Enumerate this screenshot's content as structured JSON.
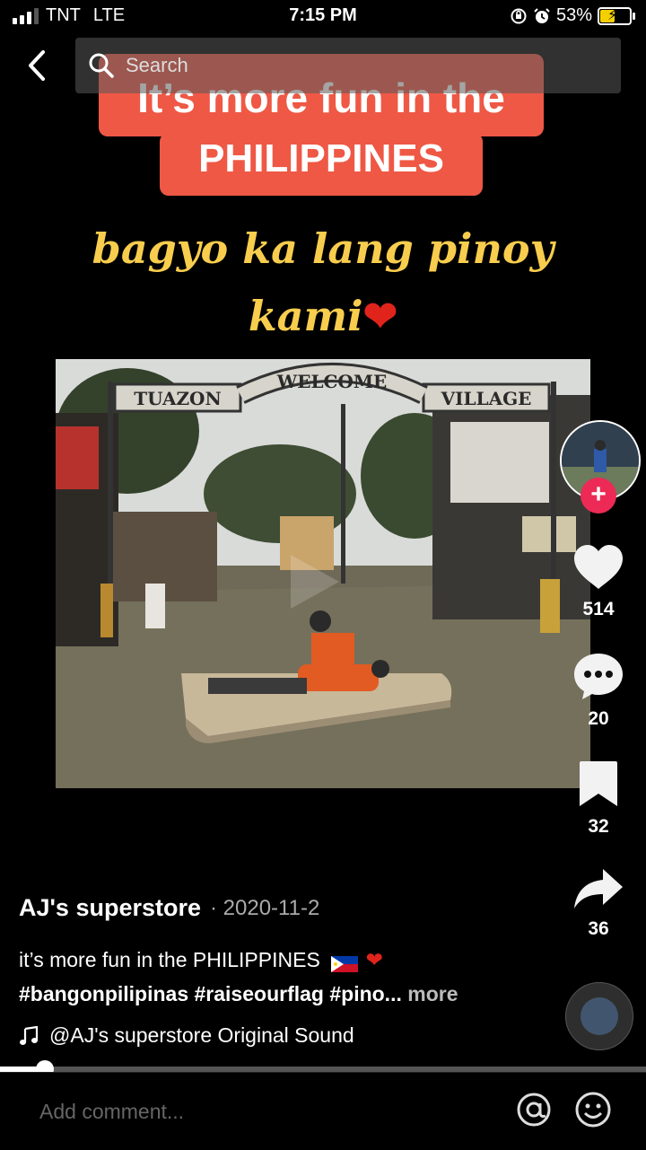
{
  "status_bar": {
    "carrier": "TNT",
    "network": "LTE",
    "time": "7:15 PM",
    "battery": "53%",
    "battery_level": 0.53,
    "icons": [
      "signal-icon",
      "orientation-lock-icon",
      "alarm-icon",
      "battery-charging-icon"
    ]
  },
  "nav": {
    "back_icon": "chevron-left-icon",
    "search_placeholder": "Search",
    "search_icon": "search-icon"
  },
  "overlay": {
    "line1": "It’s more fun in the",
    "line2": "PHILIPPINES",
    "script1": "bagyo ka lang pinoy",
    "script2": "kami",
    "script2_emoji": "❤",
    "accent": "#ee5845",
    "script_color": "#f8cd4e"
  },
  "video": {
    "sign_left": "TUAZON",
    "sign_center": "WELCOME",
    "sign_right": "VILLAGE"
  },
  "actions": {
    "likes": "514",
    "comments": "20",
    "saves": "32",
    "shares": "36",
    "follow_symbol": "+"
  },
  "post": {
    "author": "AJ's superstore",
    "date": "· 2020-11-2",
    "caption": "it’s more fun in the PHILIPPINES",
    "caption_heart": "❤",
    "hashtags": "#bangonpilipinas #raiseourflag #pino...",
    "more": " more",
    "sound": "@AJ's superstore Original Sound",
    "progress": 0.07
  },
  "comment_bar": {
    "placeholder": "Add comment..."
  }
}
